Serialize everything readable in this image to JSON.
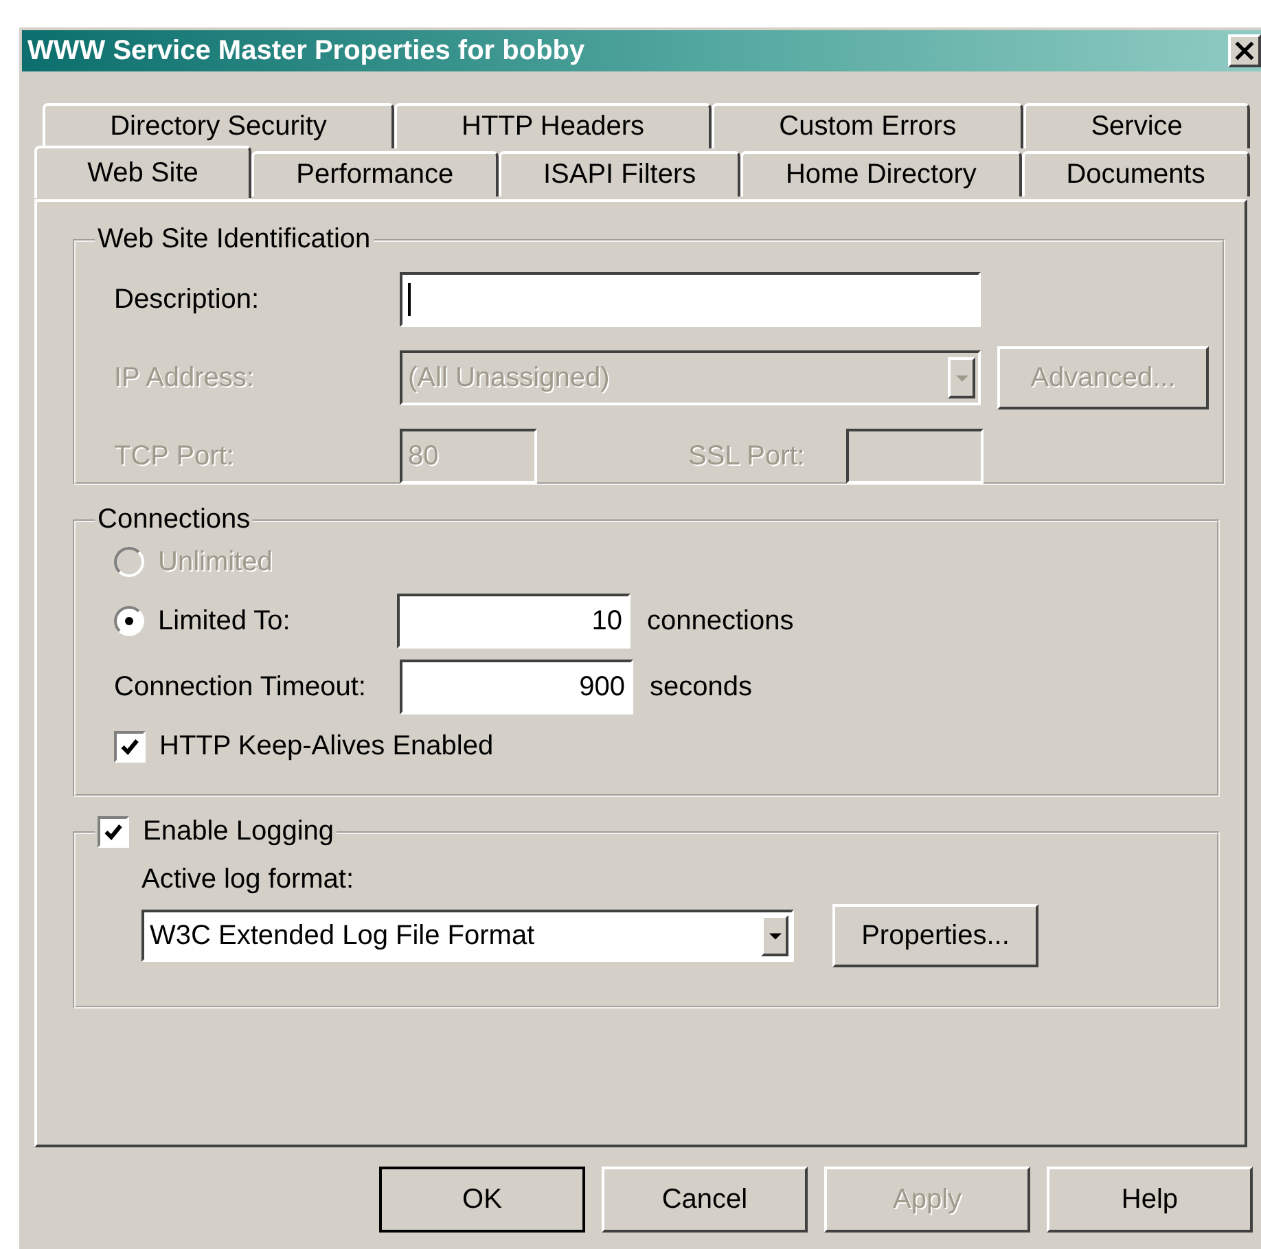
{
  "window": {
    "title": "WWW Service Master Properties for bobby"
  },
  "tab_rows": [
    [
      {
        "label": "Directory Security",
        "selected": false
      },
      {
        "label": "HTTP Headers",
        "selected": false
      },
      {
        "label": "Custom Errors",
        "selected": false
      },
      {
        "label": "Service",
        "selected": false
      }
    ],
    [
      {
        "label": "Web Site",
        "selected": true
      },
      {
        "label": "Performance",
        "selected": false
      },
      {
        "label": "ISAPI Filters",
        "selected": false
      },
      {
        "label": "Home Directory",
        "selected": false
      },
      {
        "label": "Documents",
        "selected": false
      }
    ]
  ],
  "identification": {
    "title": "Web Site Identification",
    "description": {
      "label": "Description:",
      "disabled": false
    },
    "ip_address": {
      "label": "IP Address:",
      "value": "(All Unassigned)",
      "disabled": true
    },
    "advanced_button": {
      "label": "Advanced...",
      "disabled": true
    },
    "tcp_port": {
      "label": "TCP Port:",
      "value": "80",
      "disabled": true
    },
    "ssl_port": {
      "label": "SSL Port:",
      "disabled": true
    }
  },
  "connections": {
    "title": "Connections",
    "options": [
      {
        "label": "Unlimited",
        "selected": false,
        "disabled": true
      },
      {
        "label": "Limited To:",
        "selected": true,
        "disabled": false
      }
    ],
    "limit": {
      "value": "10",
      "unit": "connections"
    },
    "timeout": {
      "label": "Connection Timeout:",
      "value": "900",
      "unit": "seconds"
    },
    "keep_alive": {
      "label": "HTTP Keep-Alives Enabled",
      "checked": true
    }
  },
  "logging": {
    "label": "Enable Logging",
    "checked": true,
    "format_label": "Active log format:",
    "format": "W3C Extended Log File Format",
    "properties_button": {
      "label": "Properties...",
      "disabled": false
    }
  },
  "buttons": [
    {
      "label": "OK",
      "default": true,
      "disabled": false
    },
    {
      "label": "Cancel",
      "default": false,
      "disabled": false
    },
    {
      "label": "Apply",
      "default": false,
      "disabled": true
    },
    {
      "label": "Help",
      "default": false,
      "disabled": false
    }
  ]
}
